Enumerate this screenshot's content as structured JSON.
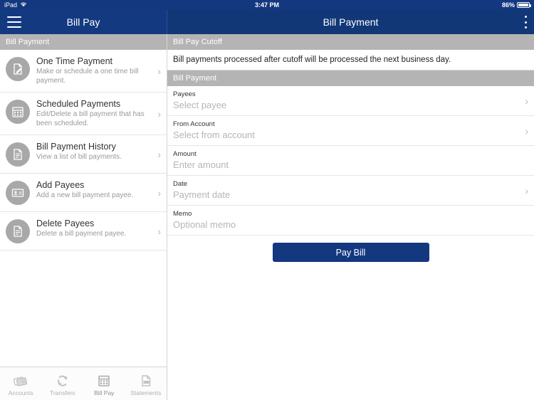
{
  "status_bar": {
    "device": "iPad",
    "wifi_icon": "wifi-icon",
    "time": "3:47 PM",
    "battery_percent": "86%",
    "battery_icon": "battery-icon"
  },
  "navbar": {
    "menu_icon": "hamburger-menu-icon",
    "left_title": "Bill Pay",
    "right_title": "Bill Payment",
    "overflow_icon": "overflow-menu-icon"
  },
  "sidebar": {
    "section_header": "Bill Payment",
    "items": [
      {
        "title": "One Time Payment",
        "subtitle": "Make or schedule a one time bill payment.",
        "icon": "document-pencil-icon"
      },
      {
        "title": "Scheduled Payments",
        "subtitle": "Edit/Delete a bill payment that has been scheduled.",
        "icon": "calendar-icon"
      },
      {
        "title": "Bill Payment History",
        "subtitle": "View a list of bill payments.",
        "icon": "document-lines-icon"
      },
      {
        "title": "Add Payees",
        "subtitle": "Add a new bill payment payee.",
        "icon": "contact-card-icon"
      },
      {
        "title": "Delete Payees",
        "subtitle": "Delete a bill payment payee.",
        "icon": "document-lines-icon"
      }
    ],
    "chevron_icon": "chevron-right-icon"
  },
  "detail": {
    "cutoff_header": "Bill Pay Cutoff",
    "cutoff_notice": "Bill payments processed after cutoff will be processed the next business day.",
    "form_header": "Bill Payment",
    "fields": [
      {
        "label": "Payees",
        "placeholder": "Select payee",
        "has_chevron": true
      },
      {
        "label": "From Account",
        "placeholder": "Select from account",
        "has_chevron": true
      },
      {
        "label": "Amount",
        "placeholder": "Enter amount",
        "has_chevron": false
      },
      {
        "label": "Date",
        "placeholder": "Payment date",
        "has_chevron": true
      },
      {
        "label": "Memo",
        "placeholder": "Optional memo",
        "has_chevron": false
      }
    ],
    "submit_label": "Pay Bill"
  },
  "tabbar": {
    "tabs": [
      {
        "label": "Accounts",
        "icon": "cards-icon",
        "active": false
      },
      {
        "label": "Transfers",
        "icon": "refresh-arrows-icon",
        "active": false
      },
      {
        "label": "Bill Pay",
        "icon": "calendar-icon",
        "active": true
      },
      {
        "label": "Statements",
        "icon": "pdf-document-icon",
        "active": false
      }
    ]
  },
  "colors": {
    "navbar_blue": "#14387f",
    "section_gray": "#b4b4b4",
    "button_blue": "#14387f",
    "icon_circle_gray": "#a8a8a8"
  }
}
